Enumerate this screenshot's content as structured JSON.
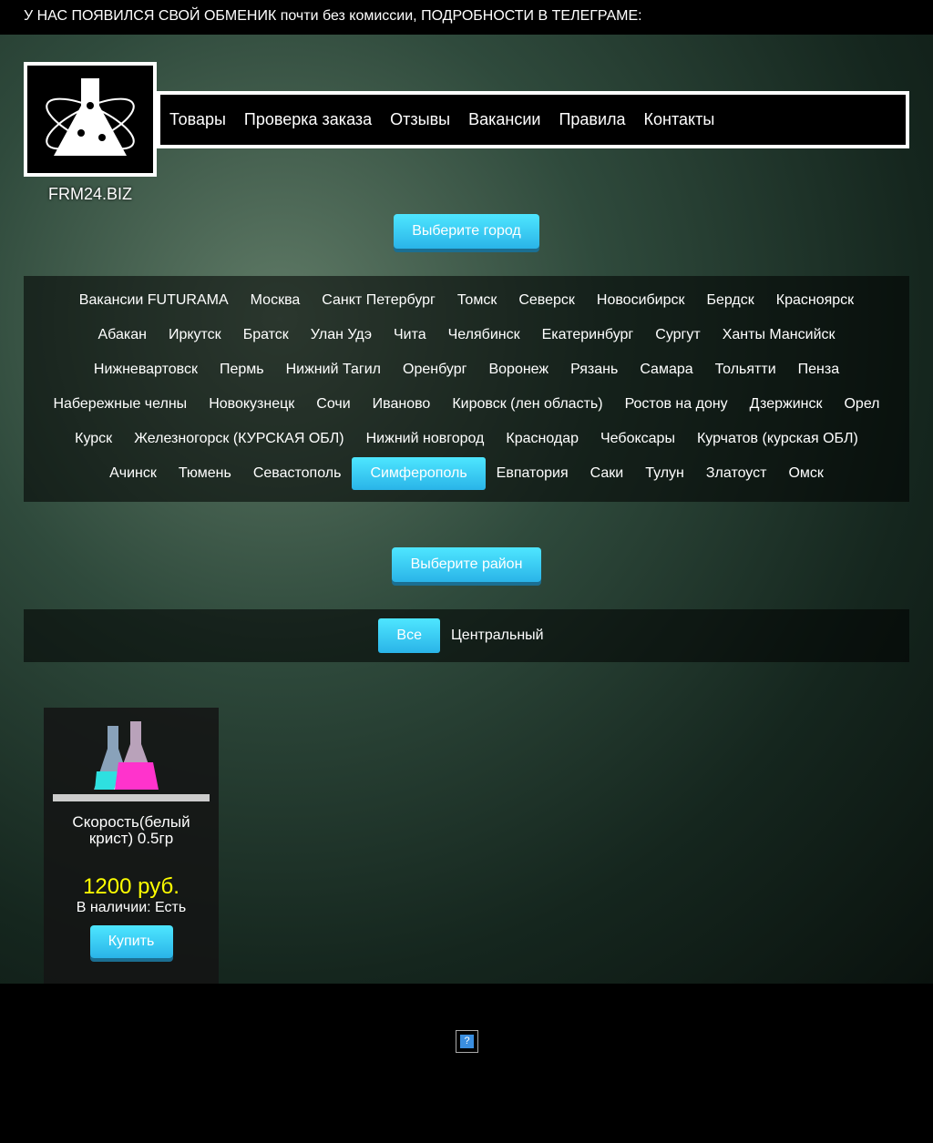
{
  "announcement": "У НАС ПОЯВИЛСЯ СВОЙ ОБМЕНИК почти без комиссии, ПОДРОБНОСТИ В ТЕЛЕГРАМЕ:",
  "brand": "FRM24.BIZ",
  "nav": [
    "Товары",
    "Проверка заказа",
    "Отзывы",
    "Вакансии",
    "Правила",
    "Контакты"
  ],
  "city_button": "Выберите город",
  "city_rows": [
    [
      "Вакансии FUTURAMA",
      "Москва",
      "Санкт Петербург",
      "Томск",
      "Северск",
      "Новосибирск",
      "Бердск",
      "Красноярск"
    ],
    [
      "Абакан",
      "Иркутск",
      "Братск",
      "Улан Удэ",
      "Чита",
      "Челябинск",
      "Екатеринбург",
      "Сургут",
      "Ханты Мансийск"
    ],
    [
      "Нижневартовск",
      "Пермь",
      "Нижний Тагил",
      "Оренбург",
      "Воронеж",
      "Рязань",
      "Самара",
      "Тольятти",
      "Пенза"
    ],
    [
      "Набережные челны",
      "Новокузнецк",
      "Сочи",
      "Иваново",
      "Кировск (лен область)",
      "Ростов на дону",
      "Дзержинск",
      "Орел"
    ],
    [
      "Курск",
      "Железногорск (КУРСКАЯ ОБЛ)",
      "Нижний новгород",
      "Краснодар",
      "Чебоксары",
      "Курчатов (курская ОБЛ)"
    ],
    [
      "Ачинск",
      "Тюмень",
      "Севастополь",
      "Симферополь",
      "Евпатория",
      "Саки",
      "Тулун",
      "Златоуст",
      "Омск"
    ]
  ],
  "active_city": "Симферополь",
  "district_button": "Выберите район",
  "districts": [
    "Все",
    "Центральный"
  ],
  "active_district": "Все",
  "product": {
    "name": "Скорость(белый крист) 0.5гр",
    "price": "1200 руб.",
    "stock": "В наличии: Есть",
    "buy": "Купить"
  },
  "colors": {
    "accent": "#3ccdf5",
    "price": "#ffff00"
  }
}
